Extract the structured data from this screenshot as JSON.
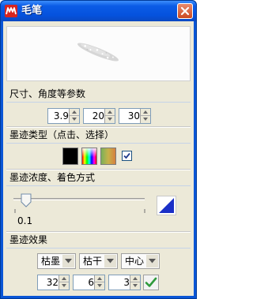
{
  "window": {
    "title": "毛笔"
  },
  "section_params": {
    "title": "尺寸、角度等参数",
    "spinners": [
      {
        "value": "3.9"
      },
      {
        "value": "20"
      },
      {
        "value": "30"
      }
    ]
  },
  "section_type": {
    "title": "墨迹类型（点击、选择）",
    "swatches": [
      {
        "name": "black"
      },
      {
        "name": "spectrum"
      },
      {
        "name": "gradient"
      }
    ],
    "checked": true
  },
  "section_density": {
    "title": "墨迹浓度、着色方式",
    "slider_value": "0.1"
  },
  "section_effect": {
    "title": "墨迹效果",
    "combos": [
      {
        "label": "枯墨"
      },
      {
        "label": "枯干"
      },
      {
        "label": "中心"
      }
    ],
    "spinners": [
      {
        "value": "32"
      },
      {
        "value": "6"
      },
      {
        "value": "3"
      }
    ]
  },
  "colors": {
    "titlebar": "#0b5ce6",
    "client_bg": "#ece9d8",
    "ok_check": "#2f9a3c",
    "triangle": "#1a2fc7"
  }
}
